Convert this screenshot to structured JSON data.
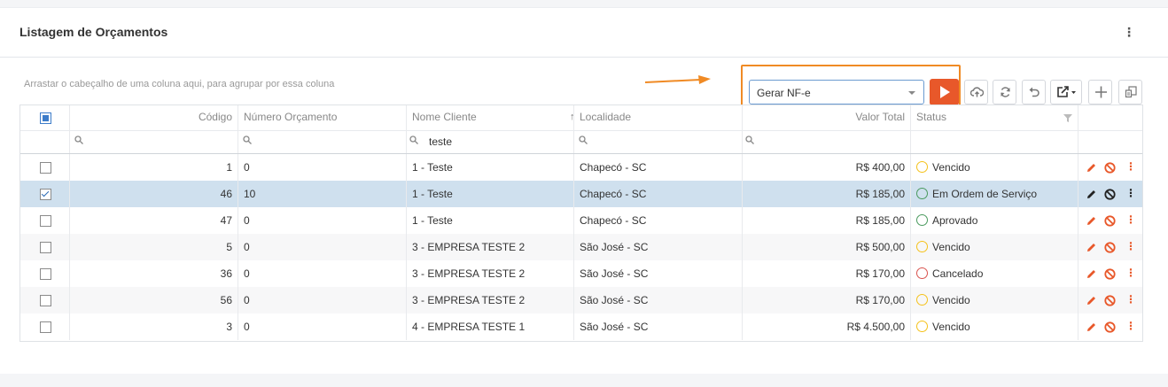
{
  "page": {
    "title": "Listagem de Orçamentos"
  },
  "toolbar": {
    "group_hint": "Arrastar o cabeçalho de uma coluna aqui, para agrupar por essa coluna",
    "action_value": "Gerar NF-e"
  },
  "columns": {
    "codigo": "Código",
    "numero": "Número Orçamento",
    "cliente": "Nome Cliente",
    "localidade": "Localidade",
    "valor": "Valor Total",
    "status": "Status"
  },
  "filters": {
    "cliente": "teste"
  },
  "rows": [
    {
      "codigo": "1",
      "numero": "0",
      "cliente": "1 - Teste",
      "localidade": "Chapecó - SC",
      "valor": "R$ 400,00",
      "status": "Vencido",
      "status_color": "#f5c21b",
      "selected": false
    },
    {
      "codigo": "46",
      "numero": "10",
      "cliente": "1 - Teste",
      "localidade": "Chapecó - SC",
      "valor": "R$ 185,00",
      "status": "Em Ordem de Serviço",
      "status_color": "#4a9a5e",
      "selected": true
    },
    {
      "codigo": "47",
      "numero": "0",
      "cliente": "1 - Teste",
      "localidade": "Chapecó - SC",
      "valor": "R$ 185,00",
      "status": "Aprovado",
      "status_color": "#4a9a5e",
      "selected": false
    },
    {
      "codigo": "5",
      "numero": "0",
      "cliente": "3 - EMPRESA TESTE 2",
      "localidade": "São José - SC",
      "valor": "R$ 500,00",
      "status": "Vencido",
      "status_color": "#f5c21b",
      "selected": false
    },
    {
      "codigo": "36",
      "numero": "0",
      "cliente": "3 - EMPRESA TESTE 2",
      "localidade": "São José - SC",
      "valor": "R$ 170,00",
      "status": "Cancelado",
      "status_color": "#d9534f",
      "selected": false
    },
    {
      "codigo": "56",
      "numero": "0",
      "cliente": "3 - EMPRESA TESTE 2",
      "localidade": "São José - SC",
      "valor": "R$ 170,00",
      "status": "Vencido",
      "status_color": "#f5c21b",
      "selected": false
    },
    {
      "codigo": "3",
      "numero": "0",
      "cliente": "4 - EMPRESA TESTE 1",
      "localidade": "São José - SC",
      "valor": "R$ 4.500,00",
      "status": "Vencido",
      "status_color": "#f5c21b",
      "selected": false
    }
  ],
  "icons": {
    "header_menu": "more-vertical-icon",
    "run": "play-icon",
    "cloud": "cloud-upload-icon",
    "refresh": "refresh-icon",
    "undo": "undo-icon",
    "export": "export-icon",
    "add": "plus-icon",
    "columns": "column-chooser-icon",
    "edit": "pencil-icon",
    "cancel": "ban-icon"
  },
  "colors": {
    "accent_orange": "#e8582a",
    "highlight_orange": "#f08a24",
    "edit_red": "#e8582a",
    "selected_row": "#cfe0ee"
  }
}
